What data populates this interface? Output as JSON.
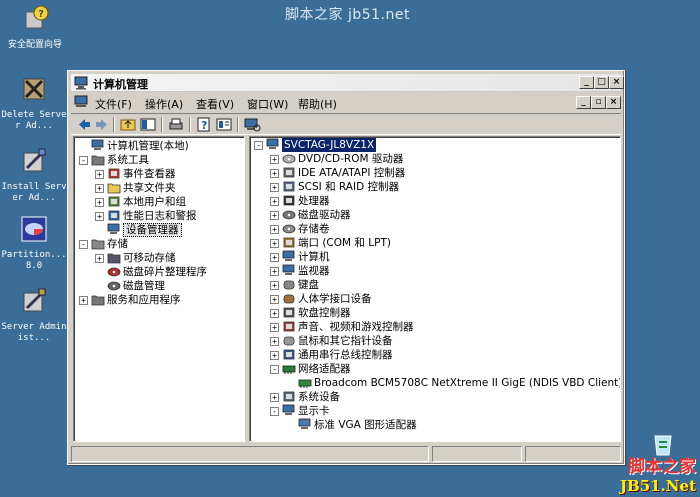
{
  "desktop": {
    "watermark_top": "脚本之家 jb51.net",
    "icons": [
      {
        "label": "安全配置向导",
        "icon": "security-wizard-icon"
      },
      {
        "label": "Delete Server Ad...",
        "icon": "delete-server-tool-icon"
      },
      {
        "label": "Install Server Ad...",
        "icon": "install-server-tool-icon"
      },
      {
        "label": "Partition... 8.0",
        "icon": "partition-magic-icon"
      },
      {
        "label": "Server Administ...",
        "icon": "server-admin-tool-icon"
      }
    ],
    "watermark_bottom_1": "脚本之家",
    "watermark_bottom_2": "JB51.Net"
  },
  "window": {
    "title": "计算机管理",
    "caption_buttons": [
      "_",
      "□",
      "×"
    ],
    "mdi_buttons": [
      "_",
      "▫",
      "×"
    ],
    "menu": [
      {
        "label": "文件",
        "key": "(F)"
      },
      {
        "label": "操作",
        "key": "(A)"
      },
      {
        "label": "查看",
        "key": "(V)"
      },
      {
        "label": "窗口",
        "key": "(W)"
      },
      {
        "label": "帮助",
        "key": "(H)"
      }
    ]
  },
  "left_tree": [
    {
      "label": "计算机管理(本地)",
      "exp": "",
      "icon": "computer-management-icon"
    },
    {
      "label": "系统工具",
      "exp": "-",
      "icon": "system-tools-icon"
    },
    {
      "label": "事件查看器",
      "exp": "+",
      "icon": "event-viewer-icon"
    },
    {
      "label": "共享文件夹",
      "exp": "+",
      "icon": "shared-folders-icon"
    },
    {
      "label": "本地用户和组",
      "exp": "+",
      "icon": "local-users-icon"
    },
    {
      "label": "性能日志和警报",
      "exp": "+",
      "icon": "performance-logs-icon"
    },
    {
      "label": "设备管理器",
      "exp": "",
      "icon": "device-manager-icon"
    },
    {
      "label": "存储",
      "exp": "-",
      "icon": "storage-icon"
    },
    {
      "label": "可移动存储",
      "exp": "+",
      "icon": "removable-storage-icon"
    },
    {
      "label": "磁盘碎片整理程序",
      "exp": "",
      "icon": "defragmenter-icon"
    },
    {
      "label": "磁盘管理",
      "exp": "",
      "icon": "disk-management-icon"
    },
    {
      "label": "服务和应用程序",
      "exp": "+",
      "icon": "services-apps-icon"
    }
  ],
  "right_tree": [
    {
      "label": "SVCTAG-JL8VZ1X",
      "exp": "-",
      "icon": "computer-icon"
    },
    {
      "label": "DVD/CD-ROM 驱动器",
      "exp": "+",
      "icon": "cdrom-icon"
    },
    {
      "label": "IDE ATA/ATAPI 控制器",
      "exp": "+",
      "icon": "ide-controller-icon"
    },
    {
      "label": "SCSI 和 RAID 控制器",
      "exp": "+",
      "icon": "scsi-controller-icon"
    },
    {
      "label": "处理器",
      "exp": "+",
      "icon": "processor-icon"
    },
    {
      "label": "磁盘驱动器",
      "exp": "+",
      "icon": "disk-drive-icon"
    },
    {
      "label": "存储卷",
      "exp": "+",
      "icon": "storage-volume-icon"
    },
    {
      "label": "端口 (COM 和 LPT)",
      "exp": "+",
      "icon": "port-icon"
    },
    {
      "label": "计算机",
      "exp": "+",
      "icon": "computer-icon"
    },
    {
      "label": "监视器",
      "exp": "+",
      "icon": "monitor-icon"
    },
    {
      "label": "键盘",
      "exp": "+",
      "icon": "keyboard-icon"
    },
    {
      "label": "人体学接口设备",
      "exp": "+",
      "icon": "hid-icon"
    },
    {
      "label": "软盘控制器",
      "exp": "+",
      "icon": "floppy-controller-icon"
    },
    {
      "label": "声音、视频和游戏控制器",
      "exp": "+",
      "icon": "sound-icon"
    },
    {
      "label": "鼠标和其它指针设备",
      "exp": "+",
      "icon": "mouse-icon"
    },
    {
      "label": "通用串行总线控制器",
      "exp": "+",
      "icon": "usb-icon"
    },
    {
      "label": "网络适配器",
      "exp": "-",
      "icon": "network-adapter-icon"
    },
    {
      "label": "Broadcom BCM5708C NetXtreme II GigE (NDIS VBD Client)",
      "exp": "",
      "icon": "network-card-icon"
    },
    {
      "label": "系统设备",
      "exp": "+",
      "icon": "system-device-icon"
    },
    {
      "label": "显示卡",
      "exp": "-",
      "icon": "display-adapter-icon"
    },
    {
      "label": "标准 VGA 图形适配器",
      "exp": "",
      "icon": "display-card-icon"
    }
  ]
}
